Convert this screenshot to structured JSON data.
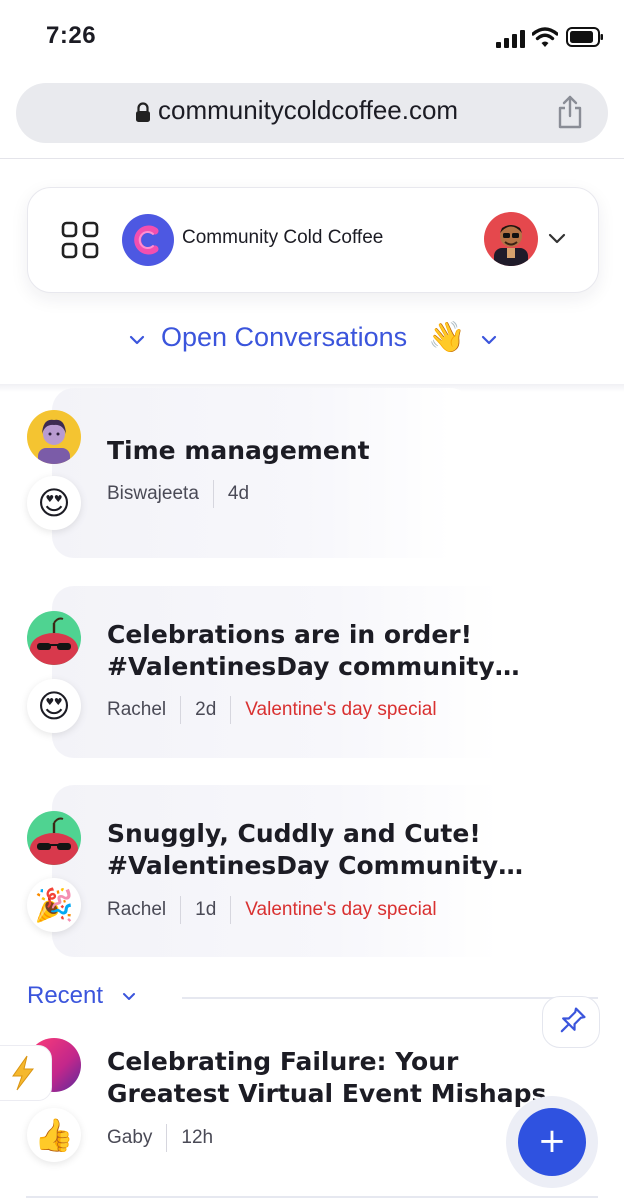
{
  "status": {
    "time": "7:26"
  },
  "browser": {
    "url": "communitycoldcoffee.com"
  },
  "header": {
    "community_name": "Community Cold Coffee"
  },
  "section": {
    "title": "Open Conversations",
    "emoji": "👋"
  },
  "conversations": [
    {
      "title": "Time management",
      "author": "Biswajeeta",
      "age": "4d",
      "tag": "",
      "reaction": "😍"
    },
    {
      "title": "Celebrations are in order! #ValentinesDay community…",
      "author": "Rachel",
      "age": "2d",
      "tag": "Valentine's day special",
      "reaction": "😍"
    },
    {
      "title": "Snuggly, Cuddly and Cute! #ValentinesDay Community…",
      "author": "Rachel",
      "age": "1d",
      "tag": "Valentine's day special",
      "reaction": "🎉"
    }
  ],
  "recent": {
    "label": "Recent",
    "post": {
      "title": "Celebrating Failure: Your Greatest Virtual Event Mishaps",
      "author": "Gaby",
      "age": "12h",
      "reaction": "👍"
    }
  },
  "icons": {
    "lock": "lock-icon",
    "share": "share-icon",
    "grid": "grid-icon",
    "pin": "pin-icon",
    "bolt": "lightning-icon",
    "add": "plus-icon",
    "chevron": "chevron-down-icon"
  },
  "colors": {
    "accent": "#3b55dc",
    "tag": "#d93131",
    "fab": "#2f52e0",
    "logo": "#4d58e2"
  },
  "fab": {
    "label": "+"
  }
}
